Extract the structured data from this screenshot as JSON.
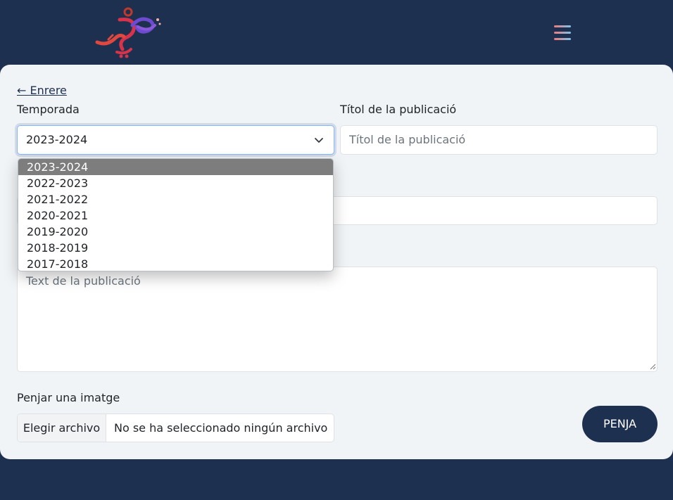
{
  "header": {
    "logo": "logo-icon",
    "menu_icon": "hamburger-menu-icon"
  },
  "form": {
    "back_label": "← Enrere",
    "season_label": "Temporada",
    "season_value": "2023-2024",
    "season_options": [
      "2023-2024",
      "2022-2023",
      "2021-2022",
      "2020-2021",
      "2019-2020",
      "2018-2019",
      "2017-2018"
    ],
    "title_label": "Títol de la publicació",
    "title_placeholder": "Títol de la publicació",
    "text_placeholder": "Text de la publicació",
    "image_label": "Penjar una imatge",
    "file_button": "Elegir archivo",
    "file_status": "No se ha seleccionado ningún archivo",
    "submit_label": "PENJA"
  },
  "colors": {
    "header_bg": "#1e3050",
    "card_bg": "#f1f4f7",
    "selected_option": "#7d7d7d"
  }
}
